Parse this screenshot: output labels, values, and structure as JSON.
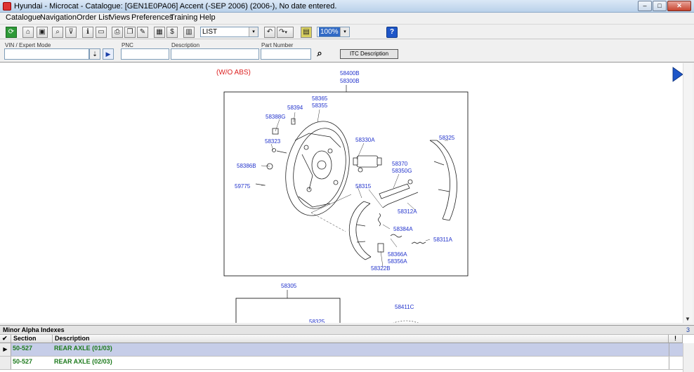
{
  "window": {
    "title": "Hyundai - Microcat - Catalogue: [GEN1E0PA06] Accent (-SEP 2006) (2006-), No date entered.",
    "min_symbol": "–",
    "max_symbol": "□",
    "close_symbol": "✕"
  },
  "menu": [
    "Catalogue",
    "Navigation",
    "Order List",
    "Views",
    "Preferences",
    "Training",
    "Help"
  ],
  "toolbar": {
    "view_select": "LIST",
    "zoom_select": "100%",
    "undo_glyph": "↶",
    "redo_glyph": "↷",
    "help_glyph": "?",
    "dropdown_glyph": "▾"
  },
  "search": {
    "vin_label": "VIN / Expert Mode",
    "vin_value": "",
    "pnc_label": "PNC",
    "pnc_value": "",
    "description_label": "Description",
    "description_value": "",
    "part_number_label": "Part Number",
    "part_number_value": "",
    "itc_button": "ITC Description",
    "binoculars_glyph": "⌕",
    "go_glyph": "▶",
    "dropdown_glyph": "⇣"
  },
  "diagram": {
    "variant_note": "(W/O ABS)",
    "assembly_codes": [
      "58400B",
      "58300B"
    ],
    "parts": [
      "58365",
      "58355",
      "58394",
      "58388G",
      "58323",
      "58386B",
      "59775",
      "58330A",
      "58325",
      "58370",
      "58350G",
      "58315",
      "58312A",
      "58384A",
      "58311A",
      "58366A",
      "58356A",
      "58322B"
    ],
    "lower": {
      "assembly": "58305",
      "part_inside": "58325",
      "part_right": "58411C"
    },
    "next_arrow": "next-page"
  },
  "minor_alpha": {
    "title": "Minor Alpha Indexes",
    "count": "3",
    "columns": [
      "Section",
      "Description"
    ],
    "flag_header": "!",
    "rows": [
      {
        "section": "50-527",
        "description": "REAR AXLE (01/03)",
        "selected": true
      },
      {
        "section": "50-527",
        "description": "REAR AXLE (02/03)",
        "selected": false
      }
    ]
  },
  "colors": {
    "note_red": "#dd2222",
    "label_blue": "#2233cc",
    "row_green": "#1d7a1d",
    "selected_row": "#c6cde8"
  }
}
